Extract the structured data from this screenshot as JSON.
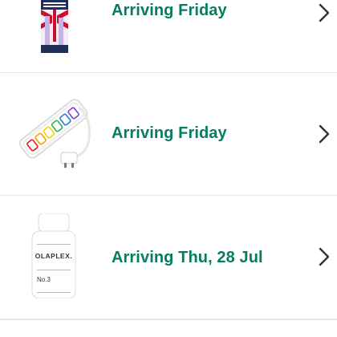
{
  "orders": [
    {
      "status": "Arriving Friday",
      "product_icon": "beauty-product-box-icon"
    },
    {
      "status": "Arriving Friday",
      "product_icon": "power-extension-strip-icon"
    },
    {
      "status": "Arriving Thu, 28 Jul",
      "product_icon": "hair-perfector-bottle-icon",
      "product_label": {
        "brand": "OLAPLEX.",
        "number": "No.3"
      }
    }
  ],
  "colors": {
    "status_green": "#067D62",
    "chevron": "#333333",
    "divider": "#e7e7e7"
  }
}
